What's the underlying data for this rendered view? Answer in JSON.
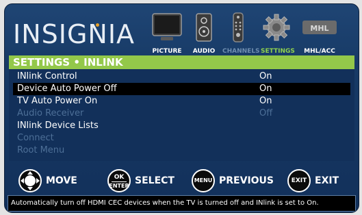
{
  "header": {
    "logo_text": "INSIGNIA",
    "tabs": [
      {
        "label": "PICTURE",
        "icon": "tv-icon"
      },
      {
        "label": "AUDIO",
        "icon": "speaker-icon"
      },
      {
        "label": "CHANNELS",
        "icon": "remote-icon"
      },
      {
        "label": "SETTINGS",
        "icon": "gear-icon"
      },
      {
        "label": "MHL/ACC",
        "icon": "mhl-icon",
        "badge": "MHL"
      }
    ]
  },
  "panel": {
    "title": "SETTINGS • INLINK",
    "items": [
      {
        "label": "INlink Control",
        "value": "On",
        "state": "normal"
      },
      {
        "label": "Device Auto Power Off",
        "value": "On",
        "state": "selected"
      },
      {
        "label": "TV Auto Power On",
        "value": "On",
        "state": "normal"
      },
      {
        "label": "Audio Receiver",
        "value": "Off",
        "state": "disabled"
      },
      {
        "label": "INlink Device Lists",
        "value": "",
        "state": "normal"
      },
      {
        "label": "Connect",
        "value": "",
        "state": "disabled"
      },
      {
        "label": "Root Menu",
        "value": "",
        "state": "disabled"
      }
    ]
  },
  "nav": {
    "move_label": "MOVE",
    "select_label": "SELECT",
    "select_key_top": "OK",
    "select_key_bottom": "ENTER",
    "previous_label": "PREVIOUS",
    "previous_key": "MENU",
    "exit_label": "EXIT",
    "exit_key": "EXIT"
  },
  "description": "Automatically turn off HDMI CEC devices when the TV is turned off and INlink is set to On.",
  "colors": {
    "accent": "#93c84a",
    "background": "#173a66",
    "selected_row": "#000000",
    "disabled_text": "#4d6f97"
  }
}
